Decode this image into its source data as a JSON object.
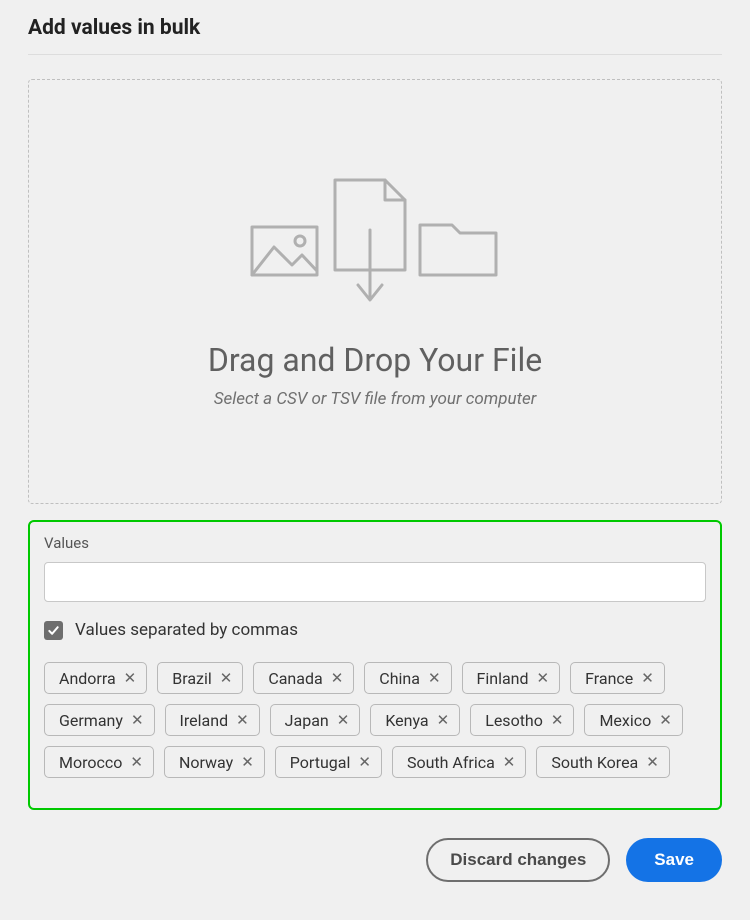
{
  "title": "Add values in bulk",
  "dropzone": {
    "heading": "Drag and Drop Your File",
    "subtitle": "Select a CSV or TSV file from your computer"
  },
  "values": {
    "label": "Values",
    "placeholder": "",
    "checkbox_label": "Values separated by commas",
    "checkbox_checked": true,
    "tags": [
      "Andorra",
      "Brazil",
      "Canada",
      "China",
      "Finland",
      "France",
      "Germany",
      "Ireland",
      "Japan",
      "Kenya",
      "Lesotho",
      "Mexico",
      "Morocco",
      "Norway",
      "Portugal",
      "South Africa",
      "South Korea"
    ]
  },
  "footer": {
    "discard": "Discard changes",
    "save": "Save"
  }
}
